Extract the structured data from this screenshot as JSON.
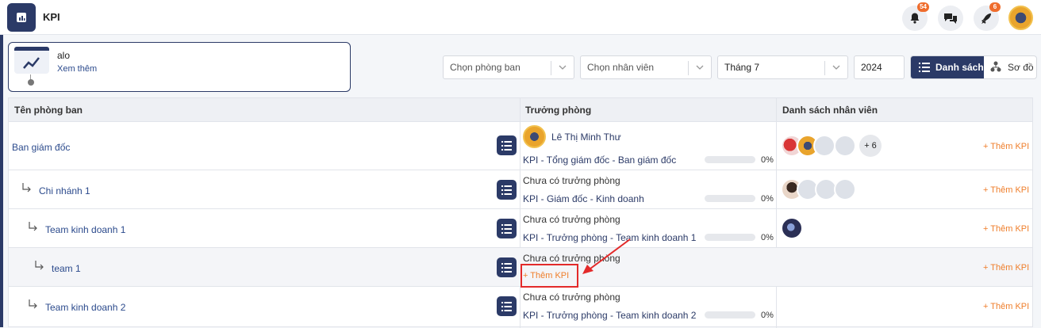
{
  "app": {
    "title": "KPI",
    "colors": {
      "brand": "#2b3a67",
      "accent": "#ef7e2b",
      "badge": "#ef6c2c",
      "highlight": "#e32a2a"
    }
  },
  "topbar": {
    "notifications": {
      "icon": "bell-icon",
      "count": "54"
    },
    "chat": {
      "icon": "chat-icon"
    },
    "rocket": {
      "icon": "rocket-icon",
      "count": "6"
    },
    "user": {
      "icon": "avatar"
    }
  },
  "summary_card": {
    "title": "alo",
    "link": "Xem thêm"
  },
  "filters": {
    "department": {
      "placeholder": "Chọn phòng ban"
    },
    "employee": {
      "placeholder": "Chọn nhân viên"
    },
    "month": {
      "value": "Tháng 7"
    },
    "year": {
      "value": "2024"
    },
    "view_list": "Danh sách",
    "view_org": "Sơ đồ"
  },
  "table": {
    "columns": [
      "Tên phòng ban",
      "Trưởng phòng",
      "Danh sách nhân viên"
    ],
    "add_kpi_label": "+ Thêm KPI",
    "rows": [
      {
        "dept": "Ban giám đốc",
        "manager": "Lê Thị Minh Thư",
        "kpi": "KPI - Tổng giám đốc - Ban giám đốc",
        "progress": 0,
        "progress_label": "0%",
        "more": "+ 6"
      },
      {
        "dept": "Chi nhánh 1",
        "manager": "Chưa có trưởng phòng",
        "kpi": "KPI - Giám đốc - Kinh doanh",
        "progress": 0,
        "progress_label": "0%"
      },
      {
        "dept": "Team kinh doanh 1",
        "manager": "Chưa có trưởng phòng",
        "kpi": "KPI - Trưởng phòng - Team kinh doanh 1",
        "progress": 0,
        "progress_label": "0%"
      },
      {
        "dept": "team 1",
        "manager": "Chưa có trưởng phòng",
        "kpi_add": "+ Thêm KPI"
      },
      {
        "dept": "Team kinh doanh 2",
        "manager": "Chưa có trưởng phòng",
        "kpi": "KPI - Trưởng phòng - Team kinh doanh 2",
        "progress": 0,
        "progress_label": "0%"
      }
    ]
  }
}
